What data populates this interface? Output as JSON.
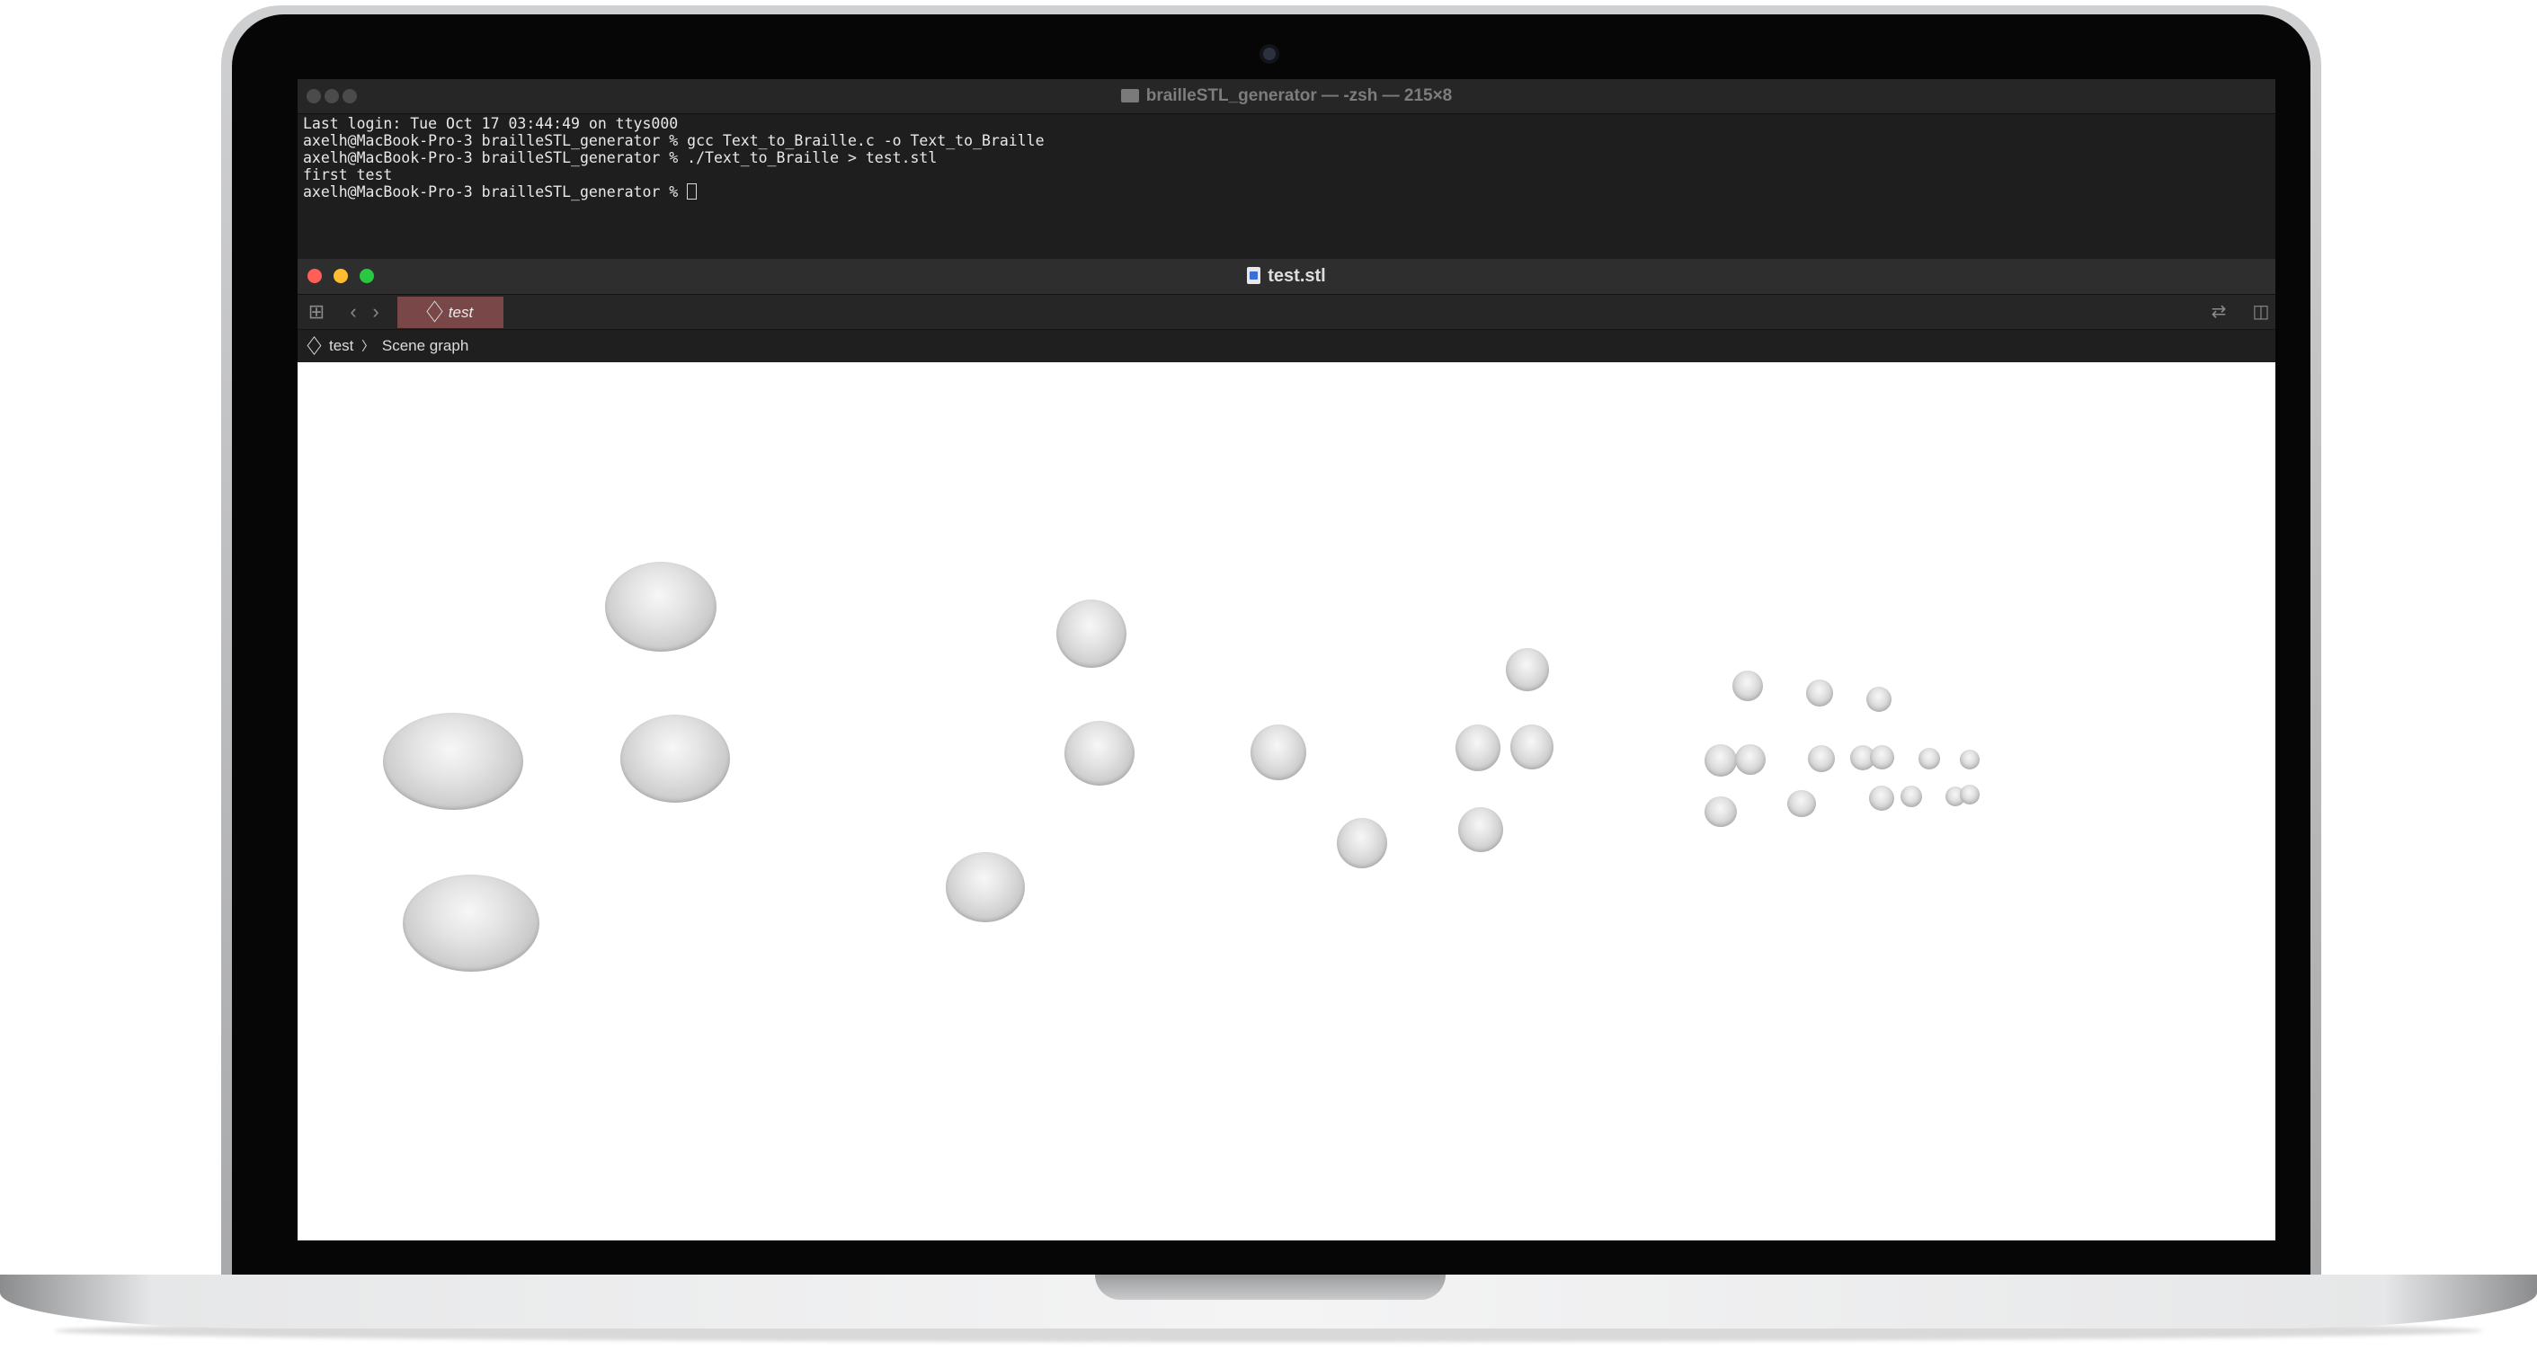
{
  "terminal": {
    "title": "brailleSTL_generator — -zsh — 215×8",
    "lines": [
      "Last login: Tue Oct 17 03:44:49 on ttys000",
      "axelh@MacBook-Pro-3 brailleSTL_generator % gcc Text_to_Braille.c -o Text_to_Braille",
      "axelh@MacBook-Pro-3 brailleSTL_generator % ./Text_to_Braille > test.stl",
      "first test",
      "axelh@MacBook-Pro-3 brailleSTL_generator % "
    ]
  },
  "viewer": {
    "title": "test.stl",
    "tab_label": "test",
    "breadcrumb": {
      "root": "test",
      "separator": "〉",
      "current": "Scene graph"
    },
    "icons": [
      "grid-icon",
      "back-icon",
      "forward-icon",
      "swap-icon",
      "inspector-icon"
    ]
  },
  "colors": {
    "close": "#ff5f57",
    "minimize": "#febc2e",
    "zoom": "#28c840",
    "tab_bg": "#7a4748"
  }
}
